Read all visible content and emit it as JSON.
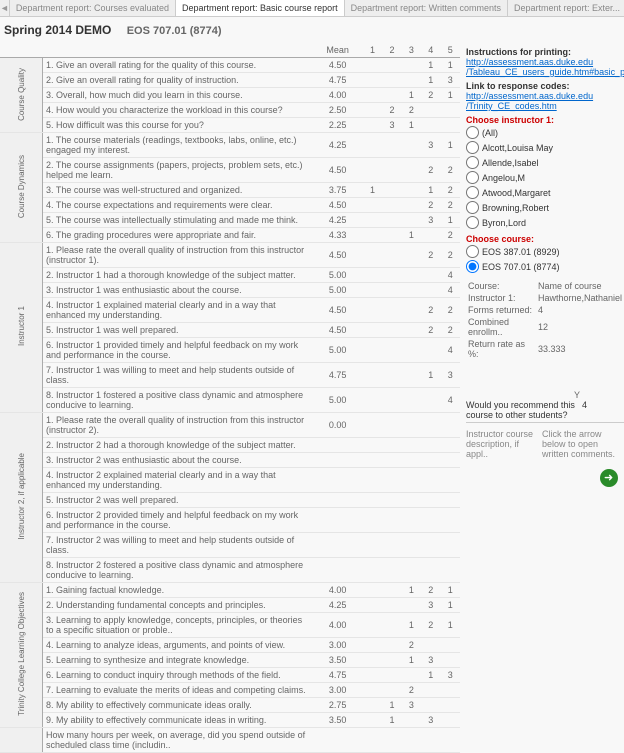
{
  "tabs": {
    "prev_icon": "◄",
    "t1": "Department report: Courses evaluated",
    "t2": "Department report: Basic course report",
    "t3": "Department report: Written comments",
    "t4": "Department report: Exter..."
  },
  "header": {
    "title": "Spring 2014 DEMO",
    "course": "EOS 707.01 (8774)"
  },
  "cols": {
    "q": "",
    "mean": "Mean",
    "c1": "1",
    "c2": "2",
    "c3": "3",
    "c4": "4",
    "c5": "5"
  },
  "sections": [
    {
      "label": "Course Quality",
      "rows": [
        {
          "q": "1. Give an overall rating for the quality of this course.",
          "m": "4.50",
          "v": [
            "",
            "",
            "",
            "1",
            "1"
          ]
        },
        {
          "q": "2. Give an overall rating for quality of instruction.",
          "m": "4.75",
          "v": [
            "",
            "",
            "",
            "1",
            "3"
          ]
        },
        {
          "q": "3. Overall, how much did you learn in this course.",
          "m": "4.00",
          "v": [
            "",
            "",
            "1",
            "2",
            "1"
          ]
        },
        {
          "q": "4. How would you characterize the workload in this course?",
          "m": "2.50",
          "v": [
            "",
            "2",
            "2",
            "",
            ""
          ]
        },
        {
          "q": "5. How difficult was this course for you?",
          "m": "2.25",
          "v": [
            "",
            "3",
            "1",
            "",
            ""
          ]
        }
      ]
    },
    {
      "label": "Course Dynamics",
      "rows": [
        {
          "q": "1. The course materials (readings, textbooks, labs, online, etc.) engaged my interest.",
          "m": "4.25",
          "v": [
            "",
            "",
            "",
            "3",
            "1"
          ]
        },
        {
          "q": "2. The course assignments (papers, projects, problem sets, etc.) helped me learn.",
          "m": "4.50",
          "v": [
            "",
            "",
            "",
            "2",
            "2"
          ]
        },
        {
          "q": "3. The course was well-structured and organized.",
          "m": "3.75",
          "v": [
            "1",
            "",
            "",
            "1",
            "2"
          ]
        },
        {
          "q": "4. The course expectations and requirements were clear.",
          "m": "4.50",
          "v": [
            "",
            "",
            "",
            "2",
            "2"
          ]
        },
        {
          "q": "5. The course was intellectually stimulating and made me think.",
          "m": "4.25",
          "v": [
            "",
            "",
            "",
            "3",
            "1"
          ]
        },
        {
          "q": "6. The grading procedures were appropriate and fair.",
          "m": "4.33",
          "v": [
            "",
            "",
            "1",
            "",
            "2"
          ]
        }
      ]
    },
    {
      "label": "Instructor 1",
      "rows": [
        {
          "q": "1. Please rate the overall quality of instruction from this instructor (instructor 1).",
          "m": "4.50",
          "v": [
            "",
            "",
            "",
            "2",
            "2"
          ]
        },
        {
          "q": "2. Instructor 1 had a thorough knowledge of the subject matter.",
          "m": "5.00",
          "v": [
            "",
            "",
            "",
            "",
            "4"
          ]
        },
        {
          "q": "3. Instructor 1 was enthusiastic about the course.",
          "m": "5.00",
          "v": [
            "",
            "",
            "",
            "",
            "4"
          ]
        },
        {
          "q": "4. Instructor 1 explained material clearly and in a way that enhanced my understanding.",
          "m": "4.50",
          "v": [
            "",
            "",
            "",
            "2",
            "2"
          ]
        },
        {
          "q": "5. Instructor 1 was well prepared.",
          "m": "4.50",
          "v": [
            "",
            "",
            "",
            "2",
            "2"
          ]
        },
        {
          "q": "6. Instructor 1 provided timely and helpful feedback on my work and performance in the course.",
          "m": "5.00",
          "v": [
            "",
            "",
            "",
            "",
            "4"
          ]
        },
        {
          "q": "7. Instructor 1 was willing to meet and help students outside of class.",
          "m": "4.75",
          "v": [
            "",
            "",
            "",
            "1",
            "3"
          ]
        },
        {
          "q": "8. Instructor 1 fostered a positive class dynamic and atmosphere conducive to learning.",
          "m": "5.00",
          "v": [
            "",
            "",
            "",
            "",
            "4"
          ]
        }
      ]
    },
    {
      "label": "Instructor 2, if applicable",
      "rows": [
        {
          "q": "1. Please rate the overall quality of instruction from this instructor (instructor 2).",
          "m": "0.00",
          "v": [
            "",
            "",
            "",
            "",
            ""
          ]
        },
        {
          "q": "2. Instructor 2 had a thorough knowledge of the subject matter.",
          "m": "",
          "v": [
            "",
            "",
            "",
            "",
            ""
          ]
        },
        {
          "q": "3. Instructor 2 was enthusiastic about the course.",
          "m": "",
          "v": [
            "",
            "",
            "",
            "",
            ""
          ]
        },
        {
          "q": "4. Instructor 2 explained material clearly and in a way that enhanced my understanding.",
          "m": "",
          "v": [
            "",
            "",
            "",
            "",
            ""
          ]
        },
        {
          "q": "5. Instructor 2 was well prepared.",
          "m": "",
          "v": [
            "",
            "",
            "",
            "",
            ""
          ]
        },
        {
          "q": "6. Instructor 2 provided timely and helpful feedback on my work and performance in the course.",
          "m": "",
          "v": [
            "",
            "",
            "",
            "",
            ""
          ]
        },
        {
          "q": "7. Instructor 2 was willing to meet and help students outside of class.",
          "m": "",
          "v": [
            "",
            "",
            "",
            "",
            ""
          ]
        },
        {
          "q": "8. Instructor 2 fostered a positive class dynamic and atmosphere conducive to learning.",
          "m": "",
          "v": [
            "",
            "",
            "",
            "",
            ""
          ]
        }
      ]
    },
    {
      "label": "Trinity College Learning Objectives",
      "rows": [
        {
          "q": "1. Gaining factual knowledge.",
          "m": "4.00",
          "v": [
            "",
            "",
            "1",
            "2",
            "1"
          ]
        },
        {
          "q": "2. Understanding fundamental concepts and principles.",
          "m": "4.25",
          "v": [
            "",
            "",
            "",
            "3",
            "1"
          ]
        },
        {
          "q": "3. Learning to apply knowledge, concepts, principles, or theories to a specific situation or proble..",
          "m": "4.00",
          "v": [
            "",
            "",
            "1",
            "2",
            "1"
          ]
        },
        {
          "q": "4. Learning to analyze ideas, arguments, and points of view.",
          "m": "3.00",
          "v": [
            "",
            "",
            "2",
            "",
            ""
          ]
        },
        {
          "q": "5. Learning to synthesize and integrate knowledge.",
          "m": "3.50",
          "v": [
            "",
            "",
            "1",
            "3",
            ""
          ]
        },
        {
          "q": "6. Learning to conduct inquiry through methods of the field.",
          "m": "4.75",
          "v": [
            "",
            "",
            "",
            "1",
            "3"
          ]
        },
        {
          "q": "7. Learning to evaluate the merits of ideas and competing claims.",
          "m": "3.00",
          "v": [
            "",
            "",
            "2",
            "",
            ""
          ]
        },
        {
          "q": "8. My ability to effectively communicate ideas orally.",
          "m": "2.75",
          "v": [
            "",
            "1",
            "3",
            "",
            ""
          ]
        },
        {
          "q": "9. My ability to effectively communicate ideas in writing.",
          "m": "3.50",
          "v": [
            "",
            "1",
            "",
            "3",
            ""
          ]
        }
      ]
    },
    {
      "label": "",
      "rows": [
        {
          "q": "How many hours per week, on average, did you spend outside of scheduled class time (includin..",
          "m": "",
          "v": [
            "",
            "",
            "",
            "",
            ""
          ]
        }
      ]
    }
  ],
  "side": {
    "instr_head": "Instructions for printing:",
    "link1": "http://assessment.aas.duke.edu",
    "link1b": "/Tableau_CE_users_guide.htm#basic_print",
    "resp_head": "Link to response codes:",
    "link2": "http://assessment.aas.duke.edu",
    "link2b": "/Trinity_CE_codes.htm",
    "choose_instr": "Choose instructor 1:",
    "instr_opts": [
      "(All)",
      "Alcott,Louisa May",
      "Allende,Isabel",
      "Angelou,M",
      "Atwood,Margaret",
      "Browning,Robert",
      "Byron,Lord"
    ],
    "choose_course": "Choose course:",
    "course_opts": [
      "EOS 387.01 (8929)",
      "EOS 707.01 (8774)"
    ],
    "meta": {
      "course_l": "Course:",
      "course_v": "Name of course",
      "instr_l": "Instructor 1:",
      "instr_v": "Hawthorne,Nathaniel",
      "forms_l": "Forms returned:",
      "forms_v": "4",
      "enroll_l": "Combined enrollm..",
      "enroll_v": "12",
      "rate_l": "Return rate as %:",
      "rate_v": "33.333"
    },
    "rec_y": "Y",
    "rec_q": "Would you recommend this course to other students?",
    "rec_v": "4",
    "desc_l": "Instructor course description, if appl..",
    "desc_r": "Click the arrow below to open written comments.",
    "arrow": "➜"
  }
}
